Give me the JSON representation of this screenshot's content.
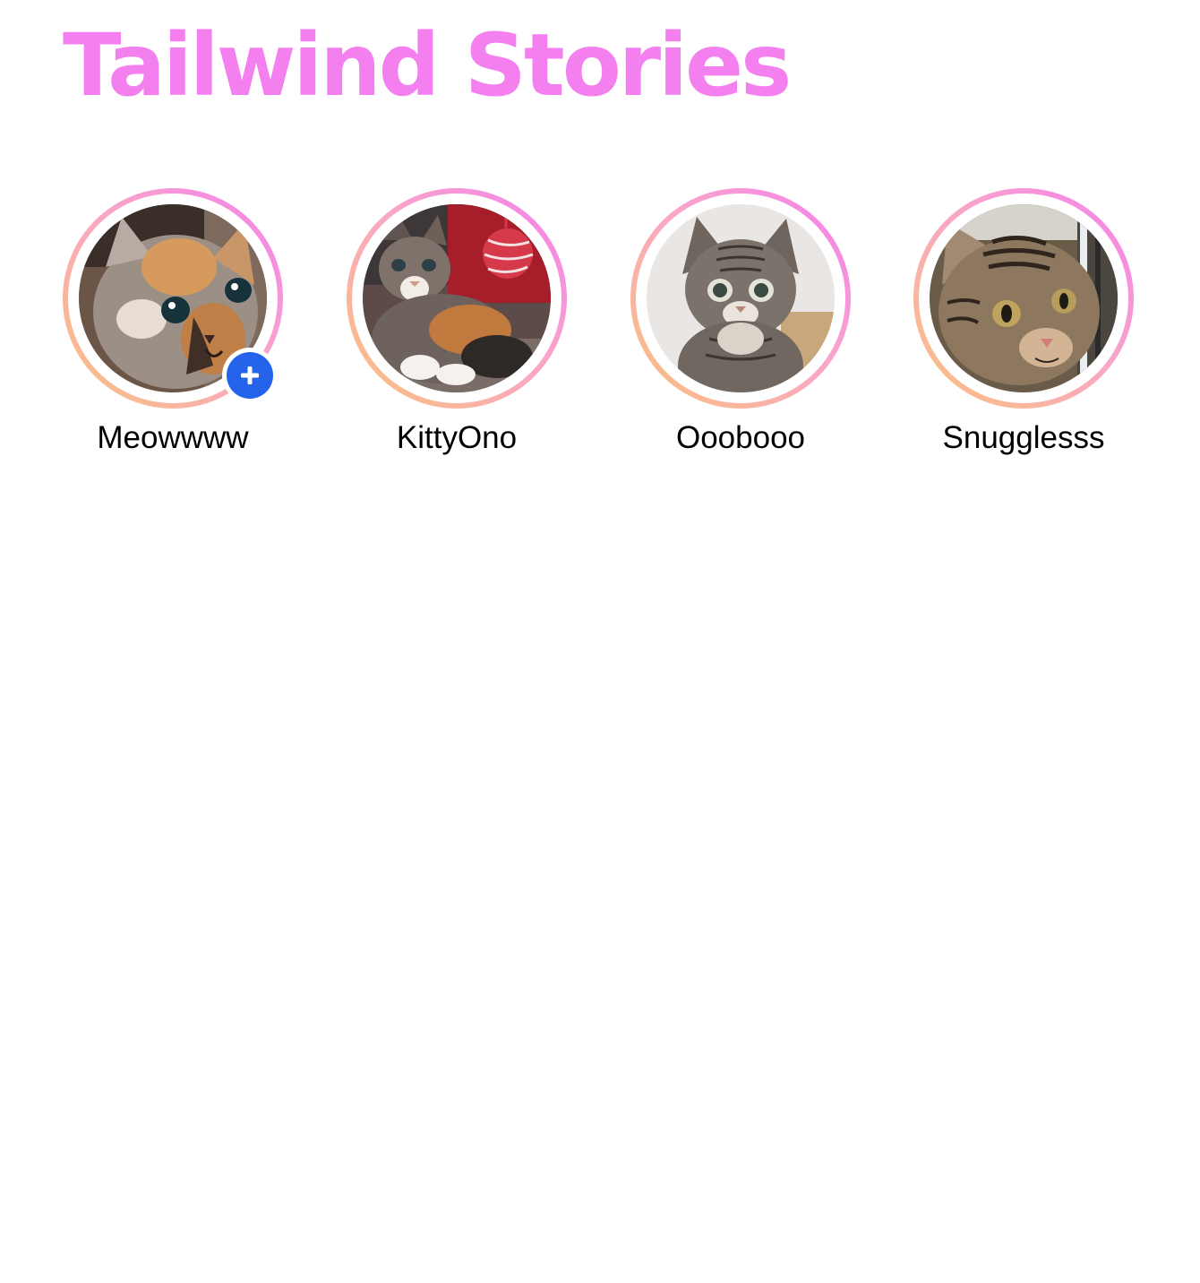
{
  "page": {
    "title": "Tailwind Stories"
  },
  "colors": {
    "title": "#f47fef",
    "ring_gradient_start": "#f47fef",
    "ring_gradient_mid": "#f9a6c8",
    "ring_gradient_end": "#fbc27a",
    "add_badge": "#2563eb"
  },
  "stories": [
    {
      "name": "Meowwww",
      "avatar_icon": "calico-kitten-avatar",
      "has_add_badge": true,
      "badge_icon": "plus-icon"
    },
    {
      "name": "KittyOno",
      "avatar_icon": "kitten-with-yarn-ball-avatar",
      "has_add_badge": false
    },
    {
      "name": "Ooobooo",
      "avatar_icon": "gray-tabby-kitten-avatar",
      "has_add_badge": false
    },
    {
      "name": "Snugglesss",
      "avatar_icon": "brown-tabby-kitten-avatar",
      "has_add_badge": false
    }
  ]
}
